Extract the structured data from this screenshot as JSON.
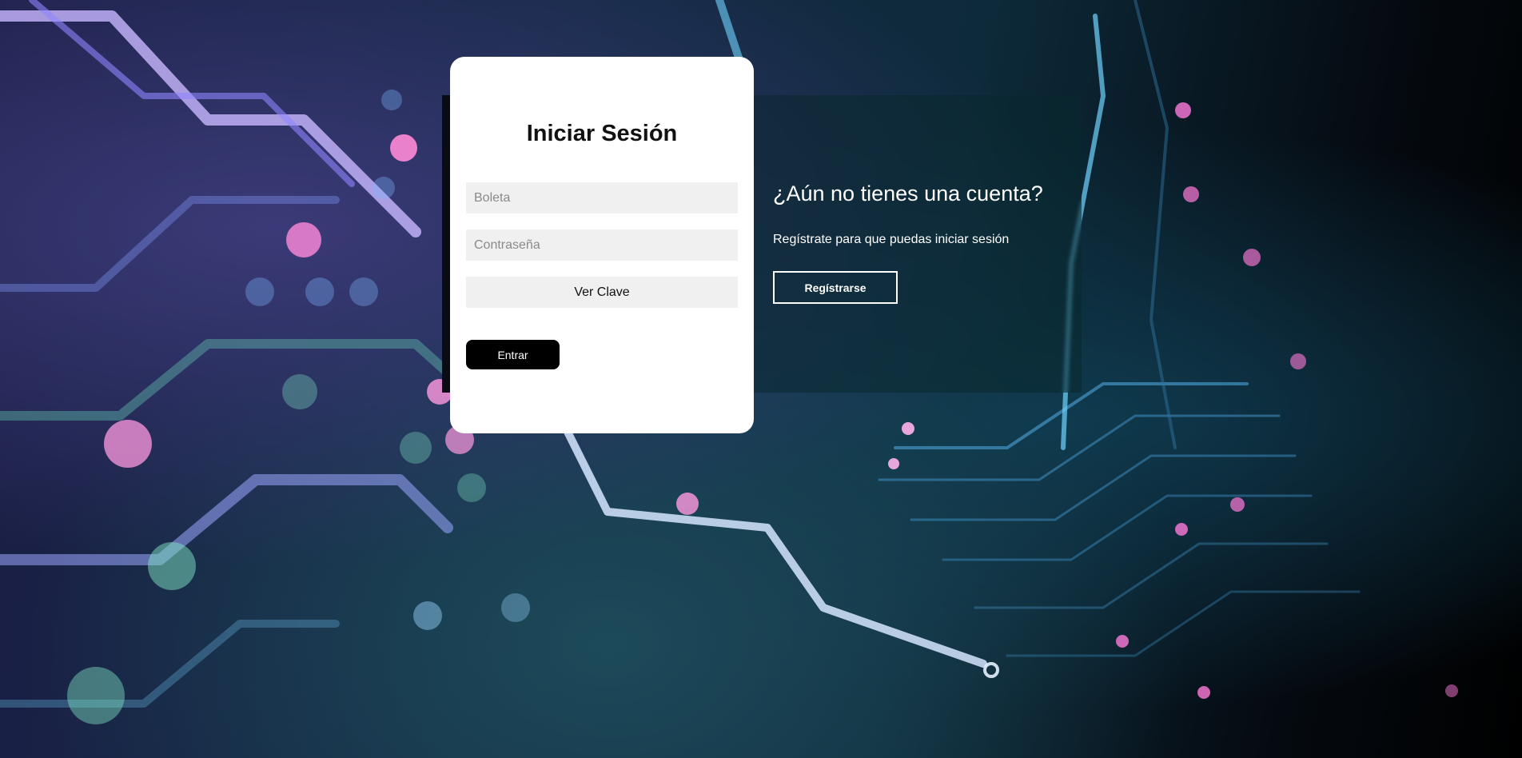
{
  "login": {
    "title": "Iniciar Sesión",
    "boleta_placeholder": "Boleta",
    "password_placeholder": "Contraseña",
    "show_password_label": "Ver Clave",
    "submit_label": "Entrar"
  },
  "register": {
    "title": "¿Aún no tienes una cuenta?",
    "text": "Regístrate para que puedas iniciar sesión",
    "button_label": "Regístrarse"
  },
  "colors": {
    "card_background": "#ffffff",
    "primary_button": "#000000",
    "input_background": "#f0f0f0",
    "accent_pink": "#ff7ad9",
    "circuit_cyan": "#6fd3ff"
  },
  "background": {
    "icon": "circuit-board-image"
  }
}
